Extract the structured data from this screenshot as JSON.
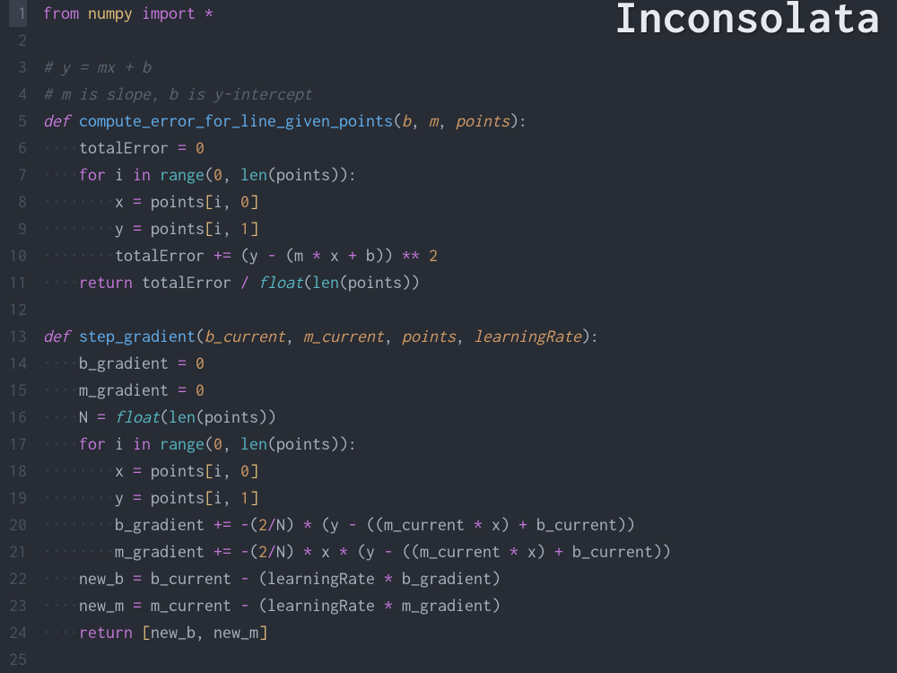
{
  "watermark": "Inconsolata",
  "gutter": {
    "active_line": 1,
    "count": 25
  },
  "code": {
    "lines": [
      [
        {
          "c": "kw",
          "t": "from"
        },
        {
          "c": "id",
          "t": " "
        },
        {
          "c": "mod",
          "t": "numpy"
        },
        {
          "c": "id",
          "t": " "
        },
        {
          "c": "kw",
          "t": "import"
        },
        {
          "c": "id",
          "t": " "
        },
        {
          "c": "op",
          "t": "*"
        }
      ],
      [],
      [
        {
          "c": "cmt",
          "t": "# y = mx + b"
        }
      ],
      [
        {
          "c": "cmt",
          "t": "# m is slope, b is y-intercept"
        }
      ],
      [
        {
          "c": "kw-it",
          "t": "def"
        },
        {
          "c": "id",
          "t": " "
        },
        {
          "c": "fn",
          "t": "compute_error_for_line_given_points"
        },
        {
          "c": "punc",
          "t": "("
        },
        {
          "c": "param",
          "t": "b"
        },
        {
          "c": "punc",
          "t": ", "
        },
        {
          "c": "param",
          "t": "m"
        },
        {
          "c": "punc",
          "t": ", "
        },
        {
          "c": "param",
          "t": "points"
        },
        {
          "c": "punc",
          "t": "):"
        }
      ],
      [
        {
          "c": "ws",
          "t": "····"
        },
        {
          "c": "id",
          "t": "totalError "
        },
        {
          "c": "op",
          "t": "="
        },
        {
          "c": "id",
          "t": " "
        },
        {
          "c": "num",
          "t": "0"
        }
      ],
      [
        {
          "c": "ws",
          "t": "····"
        },
        {
          "c": "kw",
          "t": "for"
        },
        {
          "c": "id",
          "t": " i "
        },
        {
          "c": "kw",
          "t": "in"
        },
        {
          "c": "id",
          "t": " "
        },
        {
          "c": "call",
          "t": "range"
        },
        {
          "c": "punc",
          "t": "("
        },
        {
          "c": "num",
          "t": "0"
        },
        {
          "c": "punc",
          "t": ", "
        },
        {
          "c": "call",
          "t": "len"
        },
        {
          "c": "punc",
          "t": "(points)):"
        }
      ],
      [
        {
          "c": "ws",
          "t": "········"
        },
        {
          "c": "id",
          "t": "x "
        },
        {
          "c": "op",
          "t": "="
        },
        {
          "c": "id",
          "t": " points"
        },
        {
          "c": "brack",
          "t": "["
        },
        {
          "c": "id",
          "t": "i, "
        },
        {
          "c": "num",
          "t": "0"
        },
        {
          "c": "brack",
          "t": "]"
        }
      ],
      [
        {
          "c": "ws",
          "t": "········"
        },
        {
          "c": "id",
          "t": "y "
        },
        {
          "c": "op",
          "t": "="
        },
        {
          "c": "id",
          "t": " points"
        },
        {
          "c": "brack",
          "t": "["
        },
        {
          "c": "id",
          "t": "i, "
        },
        {
          "c": "num",
          "t": "1"
        },
        {
          "c": "brack",
          "t": "]"
        }
      ],
      [
        {
          "c": "ws",
          "t": "········"
        },
        {
          "c": "id",
          "t": "totalError "
        },
        {
          "c": "op",
          "t": "+="
        },
        {
          "c": "id",
          "t": " (y "
        },
        {
          "c": "op",
          "t": "-"
        },
        {
          "c": "id",
          "t": " (m "
        },
        {
          "c": "op",
          "t": "*"
        },
        {
          "c": "id",
          "t": " x "
        },
        {
          "c": "op",
          "t": "+"
        },
        {
          "c": "id",
          "t": " b)) "
        },
        {
          "c": "op",
          "t": "**"
        },
        {
          "c": "id",
          "t": " "
        },
        {
          "c": "num",
          "t": "2"
        }
      ],
      [
        {
          "c": "ws",
          "t": "····"
        },
        {
          "c": "kw",
          "t": "return"
        },
        {
          "c": "id",
          "t": " totalError "
        },
        {
          "c": "op",
          "t": "/"
        },
        {
          "c": "id",
          "t": " "
        },
        {
          "c": "call-it",
          "t": "float"
        },
        {
          "c": "punc",
          "t": "("
        },
        {
          "c": "call",
          "t": "len"
        },
        {
          "c": "punc",
          "t": "(points))"
        }
      ],
      [],
      [
        {
          "c": "kw-it",
          "t": "def"
        },
        {
          "c": "id",
          "t": " "
        },
        {
          "c": "fn",
          "t": "step_gradient"
        },
        {
          "c": "punc",
          "t": "("
        },
        {
          "c": "param",
          "t": "b_current"
        },
        {
          "c": "punc",
          "t": ", "
        },
        {
          "c": "param",
          "t": "m_current"
        },
        {
          "c": "punc",
          "t": ", "
        },
        {
          "c": "param",
          "t": "points"
        },
        {
          "c": "punc",
          "t": ", "
        },
        {
          "c": "param",
          "t": "learningRate"
        },
        {
          "c": "punc",
          "t": "):"
        }
      ],
      [
        {
          "c": "ws",
          "t": "····"
        },
        {
          "c": "id",
          "t": "b_gradient "
        },
        {
          "c": "op",
          "t": "="
        },
        {
          "c": "id",
          "t": " "
        },
        {
          "c": "num",
          "t": "0"
        }
      ],
      [
        {
          "c": "ws",
          "t": "····"
        },
        {
          "c": "id",
          "t": "m_gradient "
        },
        {
          "c": "op",
          "t": "="
        },
        {
          "c": "id",
          "t": " "
        },
        {
          "c": "num",
          "t": "0"
        }
      ],
      [
        {
          "c": "ws",
          "t": "····"
        },
        {
          "c": "id",
          "t": "N "
        },
        {
          "c": "op",
          "t": "="
        },
        {
          "c": "id",
          "t": " "
        },
        {
          "c": "call-it",
          "t": "float"
        },
        {
          "c": "punc",
          "t": "("
        },
        {
          "c": "call",
          "t": "len"
        },
        {
          "c": "punc",
          "t": "(points))"
        }
      ],
      [
        {
          "c": "ws",
          "t": "····"
        },
        {
          "c": "kw",
          "t": "for"
        },
        {
          "c": "id",
          "t": " i "
        },
        {
          "c": "kw",
          "t": "in"
        },
        {
          "c": "id",
          "t": " "
        },
        {
          "c": "call",
          "t": "range"
        },
        {
          "c": "punc",
          "t": "("
        },
        {
          "c": "num",
          "t": "0"
        },
        {
          "c": "punc",
          "t": ", "
        },
        {
          "c": "call",
          "t": "len"
        },
        {
          "c": "punc",
          "t": "(points)):"
        }
      ],
      [
        {
          "c": "ws",
          "t": "········"
        },
        {
          "c": "id",
          "t": "x "
        },
        {
          "c": "op",
          "t": "="
        },
        {
          "c": "id",
          "t": " points"
        },
        {
          "c": "brack",
          "t": "["
        },
        {
          "c": "id",
          "t": "i, "
        },
        {
          "c": "num",
          "t": "0"
        },
        {
          "c": "brack",
          "t": "]"
        }
      ],
      [
        {
          "c": "ws",
          "t": "········"
        },
        {
          "c": "id",
          "t": "y "
        },
        {
          "c": "op",
          "t": "="
        },
        {
          "c": "id",
          "t": " points"
        },
        {
          "c": "brack",
          "t": "["
        },
        {
          "c": "id",
          "t": "i, "
        },
        {
          "c": "num",
          "t": "1"
        },
        {
          "c": "brack",
          "t": "]"
        }
      ],
      [
        {
          "c": "ws",
          "t": "········"
        },
        {
          "c": "id",
          "t": "b_gradient "
        },
        {
          "c": "op",
          "t": "+="
        },
        {
          "c": "id",
          "t": " "
        },
        {
          "c": "op",
          "t": "-"
        },
        {
          "c": "punc",
          "t": "("
        },
        {
          "c": "num",
          "t": "2"
        },
        {
          "c": "op",
          "t": "/"
        },
        {
          "c": "id",
          "t": "N) "
        },
        {
          "c": "op",
          "t": "*"
        },
        {
          "c": "id",
          "t": " (y "
        },
        {
          "c": "op",
          "t": "-"
        },
        {
          "c": "id",
          "t": " ((m_current "
        },
        {
          "c": "op",
          "t": "*"
        },
        {
          "c": "id",
          "t": " x) "
        },
        {
          "c": "op",
          "t": "+"
        },
        {
          "c": "id",
          "t": " b_current))"
        }
      ],
      [
        {
          "c": "ws",
          "t": "········"
        },
        {
          "c": "id",
          "t": "m_gradient "
        },
        {
          "c": "op",
          "t": "+="
        },
        {
          "c": "id",
          "t": " "
        },
        {
          "c": "op",
          "t": "-"
        },
        {
          "c": "punc",
          "t": "("
        },
        {
          "c": "num",
          "t": "2"
        },
        {
          "c": "op",
          "t": "/"
        },
        {
          "c": "id",
          "t": "N) "
        },
        {
          "c": "op",
          "t": "*"
        },
        {
          "c": "id",
          "t": " x "
        },
        {
          "c": "op",
          "t": "*"
        },
        {
          "c": "id",
          "t": " (y "
        },
        {
          "c": "op",
          "t": "-"
        },
        {
          "c": "id",
          "t": " ((m_current "
        },
        {
          "c": "op",
          "t": "*"
        },
        {
          "c": "id",
          "t": " x) "
        },
        {
          "c": "op",
          "t": "+"
        },
        {
          "c": "id",
          "t": " b_current))"
        }
      ],
      [
        {
          "c": "ws",
          "t": "····"
        },
        {
          "c": "id",
          "t": "new_b "
        },
        {
          "c": "op",
          "t": "="
        },
        {
          "c": "id",
          "t": " b_current "
        },
        {
          "c": "op",
          "t": "-"
        },
        {
          "c": "id",
          "t": " (learningRate "
        },
        {
          "c": "op",
          "t": "*"
        },
        {
          "c": "id",
          "t": " b_gradient)"
        }
      ],
      [
        {
          "c": "ws",
          "t": "····"
        },
        {
          "c": "id",
          "t": "new_m "
        },
        {
          "c": "op",
          "t": "="
        },
        {
          "c": "id",
          "t": " m_current "
        },
        {
          "c": "op",
          "t": "-"
        },
        {
          "c": "id",
          "t": " (learningRate "
        },
        {
          "c": "op",
          "t": "*"
        },
        {
          "c": "id",
          "t": " m_gradient)"
        }
      ],
      [
        {
          "c": "ws",
          "t": "····"
        },
        {
          "c": "kw",
          "t": "return"
        },
        {
          "c": "id",
          "t": " "
        },
        {
          "c": "brack",
          "t": "["
        },
        {
          "c": "id",
          "t": "new_b, new_m"
        },
        {
          "c": "brack",
          "t": "]"
        }
      ],
      []
    ]
  }
}
